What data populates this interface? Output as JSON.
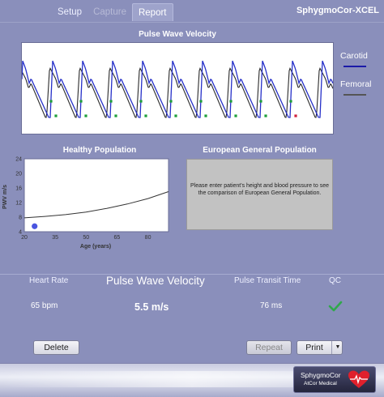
{
  "app": {
    "brand": "SphygmoCor-XCEL"
  },
  "tabs": [
    {
      "label": "Setup",
      "state": "normal"
    },
    {
      "label": "Capture",
      "state": "disabled"
    },
    {
      "label": "Report",
      "state": "active"
    }
  ],
  "pwv_panel": {
    "title": "Pulse Wave Velocity",
    "legend": [
      {
        "label": "Carotid",
        "color": "#1a1aa8"
      },
      {
        "label": "Femoral",
        "color": "#555555"
      }
    ],
    "carotid_color": "#2630c9",
    "femoral_color": "#2a2a2a"
  },
  "healthy_panel": {
    "title": "Healthy Population",
    "chart_data": {
      "type": "scatter",
      "xlabel": "Age (years)",
      "ylabel": "PWV m/s",
      "x_ticks": [
        "20",
        "35",
        "50",
        "65",
        "80"
      ],
      "y_ticks": [
        "4",
        "8",
        "12",
        "16",
        "20",
        "24"
      ],
      "xlim": [
        20,
        90
      ],
      "ylim": [
        4,
        24
      ],
      "reference_curve": {
        "x": [
          20,
          30,
          40,
          50,
          60,
          70,
          80,
          90
        ],
        "y": [
          7.8,
          8.2,
          8.7,
          9.4,
          10.4,
          11.6,
          13.1,
          15.0
        ]
      },
      "point": {
        "x": 25,
        "y": 5.5,
        "color": "#4a55e0"
      }
    }
  },
  "european_panel": {
    "title": "European General Population",
    "message": "Please enter patient's height and blood pressure to see the comparison of European General Population."
  },
  "results": {
    "heart_rate_label": "Heart Rate",
    "pwv_label": "Pulse Wave Velocity",
    "ptt_label": "Pulse Transit Time",
    "qc_label": "QC",
    "heart_rate_value": "65 bpm",
    "pwv_value": "5.5 m/s",
    "ptt_value": "76 ms",
    "qc_status": "check-icon"
  },
  "buttons": {
    "delete": "Delete",
    "repeat": "Repeat",
    "print": "Print"
  },
  "footer": {
    "logo_line1": "SphygmoCor",
    "logo_line2": "AtCor Medical"
  }
}
